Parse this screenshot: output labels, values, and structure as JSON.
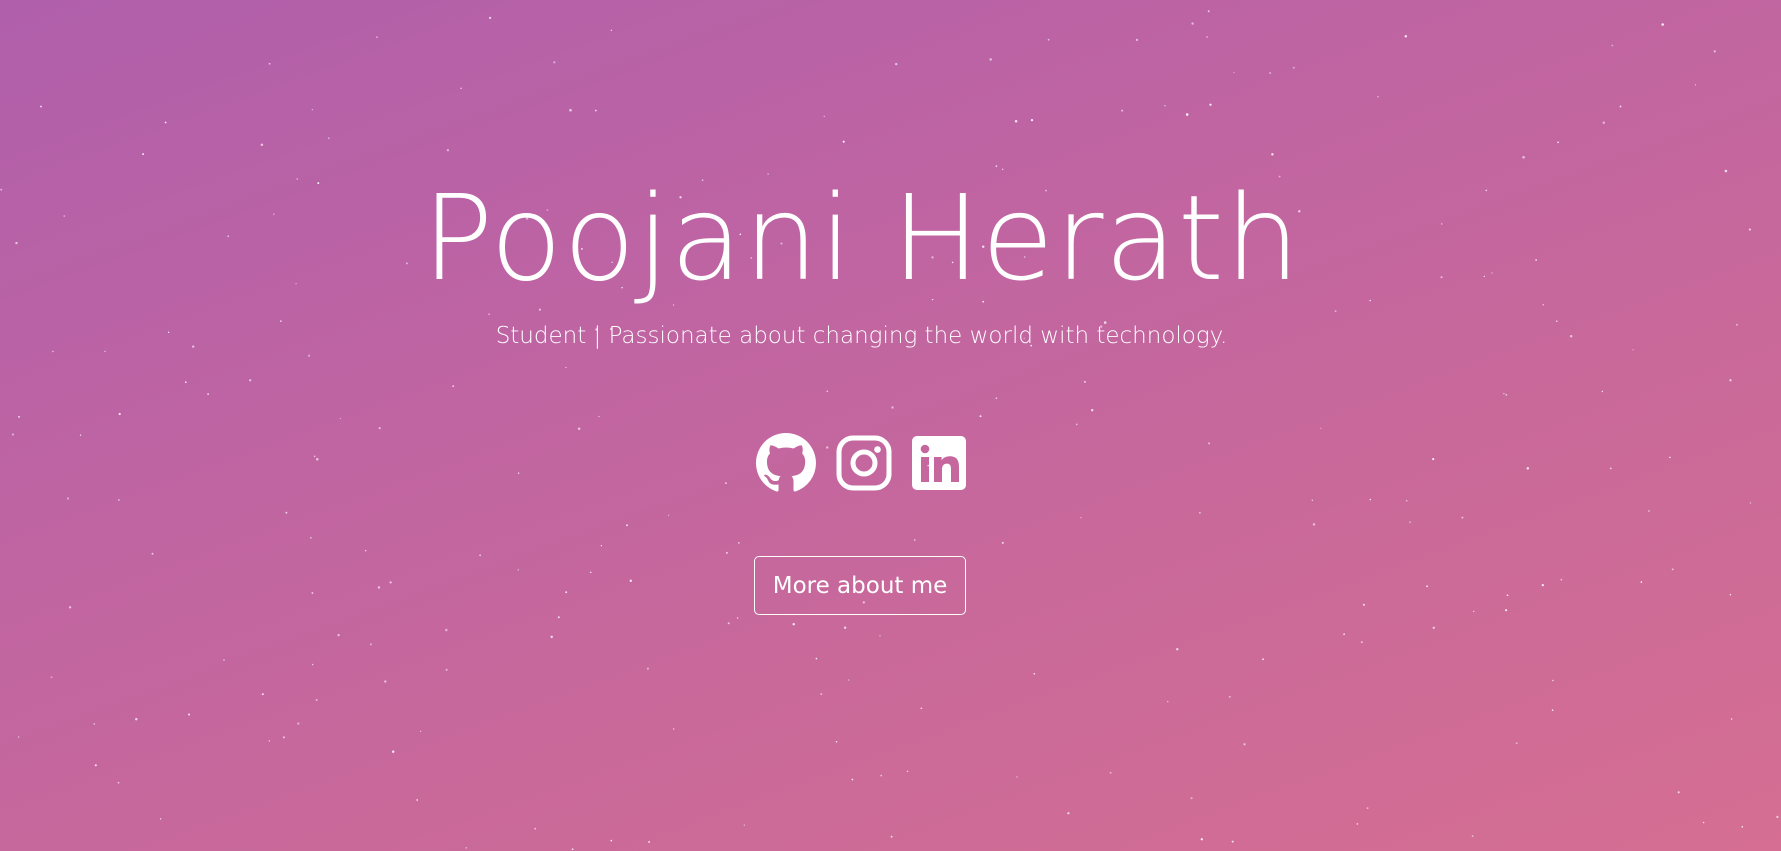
{
  "theme": {
    "gradient_start": "#b05fab",
    "gradient_end": "#d56e92",
    "text_color": "#ffffff"
  },
  "hero": {
    "name": "Poojani Herath",
    "tagline": "Student | Passionate about changing the world with technology."
  },
  "social": [
    {
      "icon": "github-icon"
    },
    {
      "icon": "instagram-icon"
    },
    {
      "icon": "linkedin-icon"
    }
  ],
  "cta": {
    "label": "More about me"
  }
}
